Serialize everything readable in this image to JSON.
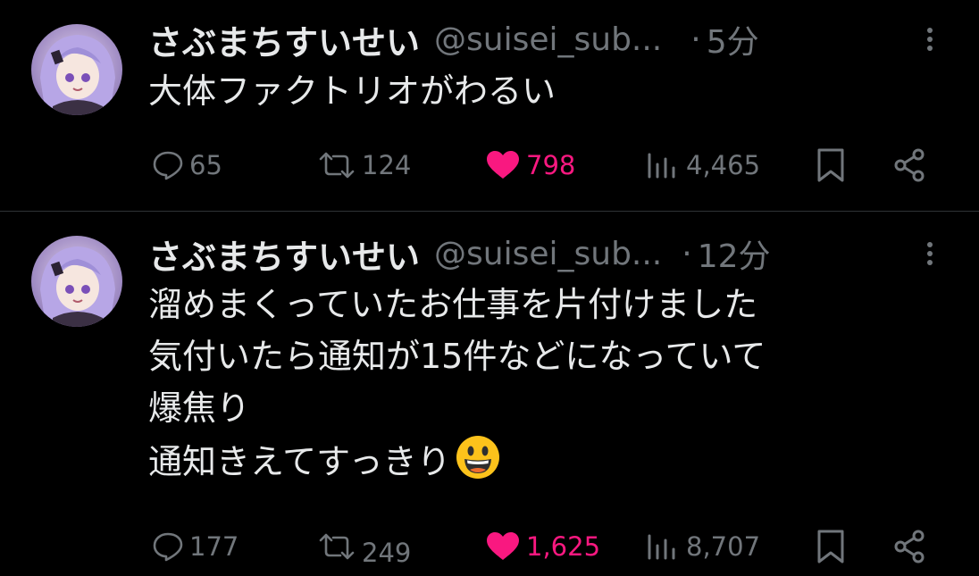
{
  "tweets": [
    {
      "author": {
        "display_name": "さぶまちすいせい",
        "handle": "@suisei_sub..."
      },
      "dot": "·",
      "time": "5分",
      "text": "大体ファクトリオがわるい",
      "stats": {
        "replies": "65",
        "retweets": "124",
        "likes": "798",
        "views": "4,465"
      },
      "liked": true
    },
    {
      "author": {
        "display_name": "さぶまちすいせい",
        "handle": "@suisei_sub..."
      },
      "dot": "·",
      "time": "12分",
      "text": "溜めまくっていたお仕事を片付けました\n気付いたら通知が15件などになっていて\n爆焦り\n通知きえてすっきり",
      "emoji": "grinning-face-emoji",
      "stats": {
        "replies": "177",
        "retweets": "249",
        "likes": "1,625",
        "views": "8,707"
      },
      "liked": true
    }
  ],
  "colors": {
    "background": "#000000",
    "text": "#e7e9ea",
    "secondary": "#71767b",
    "like": "#f91880",
    "divider": "#2f3336"
  },
  "icons": {
    "reply": "reply-icon",
    "retweet": "retweet-icon",
    "like": "heart-icon",
    "views": "views-icon",
    "bookmark": "bookmark-icon",
    "share": "share-icon",
    "more": "more-icon"
  }
}
